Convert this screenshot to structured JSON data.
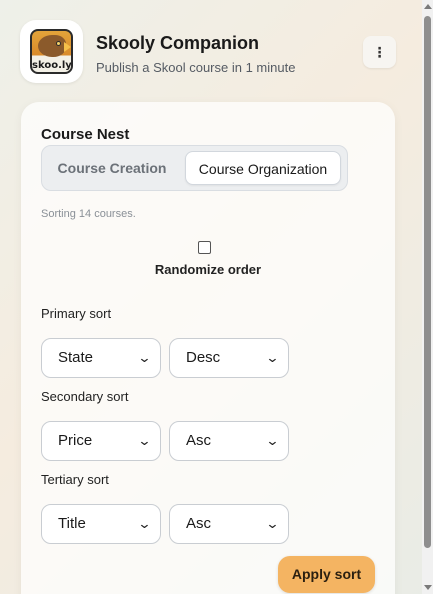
{
  "header": {
    "title": "Skooly Companion",
    "subtitle": "Publish a Skool course in 1 minute",
    "logo_text": "skoo.ly",
    "menu_icon": "more-vertical-icon",
    "menu_glyph": "⋮"
  },
  "card": {
    "title": "Course Nest",
    "tabs": [
      {
        "label": "Course Creation",
        "active": false
      },
      {
        "label": "Course Organization",
        "active": true
      }
    ],
    "status": "Sorting 14 courses.",
    "randomize": {
      "label": "Randomize order",
      "checked": false
    },
    "sorts": [
      {
        "label": "Primary sort",
        "field": "State",
        "direction": "Desc"
      },
      {
        "label": "Secondary sort",
        "field": "Price",
        "direction": "Asc"
      },
      {
        "label": "Tertiary sort",
        "field": "Title",
        "direction": "Asc"
      }
    ],
    "apply_label": "Apply sort"
  },
  "colors": {
    "accent": "#f4b462",
    "tab_active_bg": "#ffffff",
    "tab_bar_bg": "#eceef0"
  },
  "icons": {
    "select_chevron": "chevron-down-icon",
    "chevron_glyph": "⌄"
  }
}
